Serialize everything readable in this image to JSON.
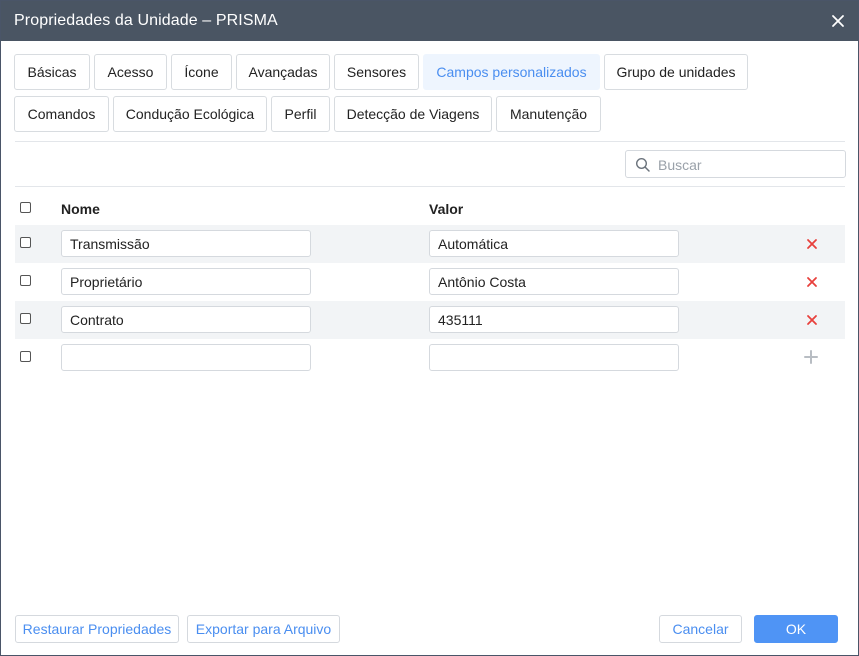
{
  "window": {
    "title": "Propriedades da Unidade – PRISMA",
    "close_icon": "close-icon"
  },
  "tabs": [
    {
      "label": "Básicas",
      "active": false
    },
    {
      "label": "Acesso",
      "active": false
    },
    {
      "label": "Ícone",
      "active": false
    },
    {
      "label": "Avançadas",
      "active": false
    },
    {
      "label": "Sensores",
      "active": false
    },
    {
      "label": "Campos personalizados",
      "active": true
    },
    {
      "label": "Grupo de unidades",
      "active": false
    },
    {
      "label": "Comandos",
      "active": false
    },
    {
      "label": "Condução Ecológica",
      "active": false
    },
    {
      "label": "Perfil",
      "active": false
    },
    {
      "label": "Detecção de Viagens",
      "active": false
    },
    {
      "label": "Manutenção",
      "active": false
    }
  ],
  "search": {
    "placeholder": "Buscar",
    "value": "",
    "icon": "search-icon"
  },
  "table": {
    "columns": {
      "name": "Nome",
      "value": "Valor"
    },
    "rows": [
      {
        "name": "Transmissão",
        "value": "Automática",
        "checked": false
      },
      {
        "name": "Proprietário",
        "value": "Antônio Costa",
        "checked": false
      },
      {
        "name": "Contrato",
        "value": "435111",
        "checked": false
      }
    ],
    "new_row": {
      "name": "",
      "value": ""
    }
  },
  "footer": {
    "restore_label": "Restaurar Propriedades",
    "export_label": "Exportar para Arquivo",
    "cancel_label": "Cancelar",
    "ok_label": "OK"
  },
  "colors": {
    "titlebar": "#4a5563",
    "accent": "#4a8ef0",
    "primary_button": "#4f94f5",
    "delete_icon": "#e8403c"
  }
}
